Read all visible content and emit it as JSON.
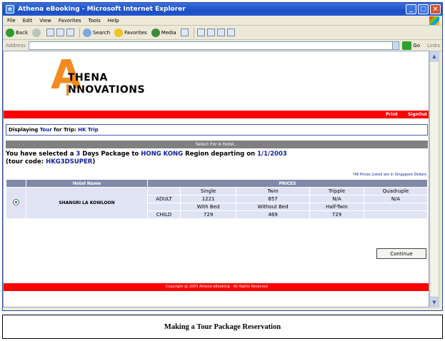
{
  "window": {
    "title": "Athena eBooking - Microsoft Internet Explorer"
  },
  "menu": [
    "File",
    "Edit",
    "View",
    "Favorites",
    "Tools",
    "Help"
  ],
  "toolbar": {
    "back": "Back",
    "search": "Search",
    "favorites": "Favorites",
    "media": "Media"
  },
  "address": {
    "label": "Address",
    "go": "Go",
    "links": "Links"
  },
  "logo": {
    "letter": "A",
    "line1": "THENA",
    "line2": "NNOVATIONS"
  },
  "topbar": {
    "print": "Print",
    "signout": "SignOut"
  },
  "trip": {
    "prefix": "Displaying",
    "type": "Tour",
    "mid": "for Trip:",
    "name": "HK Trip"
  },
  "hotel_header": "Select For A Hotel...",
  "selection": {
    "p1": "You have selected a",
    "days": "3",
    "p2": "Days Package to",
    "destination": "HONG KONG",
    "p3": "Region departing on",
    "date": "1/1/2003",
    "p4": "(tour code:",
    "code": "HKG3DSUPER",
    "p5": ")"
  },
  "footnote": "*All Prices Listed are in Singapore Dollars",
  "table": {
    "col_hotel": "Hotel Name",
    "col_prices": "PRICES",
    "hotel": "SHANGRI LA KOWLOON",
    "adult": {
      "label": "ADULT",
      "headers": [
        "Single",
        "Twin",
        "Tripple",
        "Quadruple"
      ],
      "values": [
        "1221",
        "857",
        "N/A",
        "N/A"
      ]
    },
    "child": {
      "label": "CHILD",
      "headers": [
        "With Bed",
        "Without Bed",
        "Half-Twin"
      ],
      "values": [
        "729",
        "469",
        "729"
      ]
    }
  },
  "continue_label": "Continue",
  "footer": "Copyright @ 2003 Athena eBooking - All Rights Reserved",
  "caption": "Making a Tour Package Reservation"
}
